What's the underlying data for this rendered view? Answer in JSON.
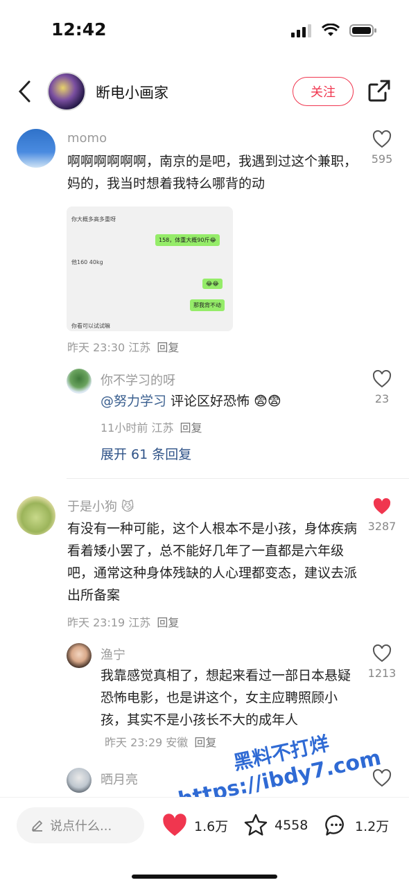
{
  "status": {
    "time": "12:42"
  },
  "header": {
    "title": "断电小画家",
    "follow_label": "关注"
  },
  "comments": [
    {
      "user": "momo",
      "text": "啊啊啊啊啊啊，南京的是吧，我遇到过这个兼职，妈的，我当时想着我特么哪背的动",
      "meta": "昨天 23:30 江苏",
      "reply_label": "回复",
      "likes": "595",
      "chat": {
        "m1": "你大概多高多重呀",
        "m2": "158，体重大概90斤😂",
        "m3": "他160 40kg",
        "m4": "😂😂",
        "m5": "那我背不动",
        "m6": "你看可以试试嘛"
      }
    },
    {
      "user": "你不学习的呀",
      "mention": "@努力学习",
      "text": " 评论区好恐怖 😨😨",
      "meta": "11小时前 江苏",
      "reply_label": "回复",
      "likes": "23"
    },
    {
      "user": "于是小狗 😼",
      "text": "有没有一种可能，这个人根本不是小孩，身体疾病看着矮小罢了，总不能好几年了一直都是六年级吧，通常这种身体残缺的人心理都变态，建议去派出所备案",
      "meta": "昨天 23:19 江苏",
      "reply_label": "回复",
      "likes": "3287"
    },
    {
      "user": "渔宁",
      "text": "我靠感觉真相了，想起来看过一部日本悬疑恐怖电影，也是讲这个，女主应聘照顾小孩，其实不是小孩长不大的成年人",
      "meta": "昨天 23:29 安徽",
      "reply_label": "回复",
      "likes": "1213"
    },
    {
      "user": "晒月亮"
    }
  ],
  "expand_label": "展开 61 条回复",
  "watermark": {
    "line1": "黑料不打烊",
    "line2": "https://ibdy7.com"
  },
  "bottom": {
    "placeholder": "说点什么...",
    "likes": "1.6万",
    "favorites": "4558",
    "comments": "1.2万"
  },
  "colors": {
    "accent": "#f0364f",
    "link": "#2f5388"
  }
}
